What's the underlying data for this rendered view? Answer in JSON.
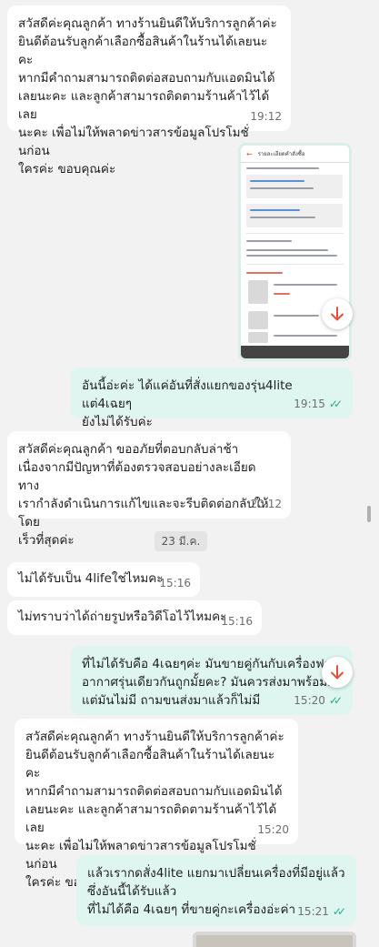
{
  "messages": [
    {
      "id": "m1",
      "side": "in",
      "text": "สวัสดีค่ะคุณลูกค้า ทางร้านยินดีให้บริการลูกค้าค่ะ\nยินดีต้อนรับลูกค้าเลือกซื้อสินค้าในร้านได้เลยนะคะ\nหากมีคำถามสามารถติดต่อสอบถามกับแอดมินได้\nเลยนะคะ และลูกค้าสามารถติดตามร้านค้าไว้ได้เลย\nนะคะ เพื่อไม่ให้พลาดข่าวสารข้อมูลโปรโมชั่นก่อน\nใครค่ะ ขอบคุณค่ะ",
      "time": "19:12"
    },
    {
      "id": "m2",
      "side": "out",
      "type": "image",
      "screenshot_title": "รายละเอียดคำสั่งซื้อ"
    },
    {
      "id": "m3",
      "side": "out",
      "text": "อันนี้อ่ะค่ะ ได้แค่อันที่สั่งแยกของรุ่น4lite แต่4เฉยๆ\nยังไม่ได้รับค่ะ",
      "time": "19:15",
      "read": true
    },
    {
      "id": "m4",
      "side": "in",
      "text": "สวัสดีค่ะคุณลูกค้า ขออภัยที่ตอบกลับล่าช้า\nเนื่องจากมีปัญหาที่ต้องตรวจสอบอย่างละเอียด ทาง\nเรากำลังดำเนินการแก้ไขและจะรีบติดต่อกลับให้โดย\nเร็วที่สุดค่ะ",
      "time": "20:12"
    },
    {
      "id": "m5",
      "side": "in",
      "text": "ไม่ได้รับเป็น 4lifeใช่ไหมคะ",
      "time": "15:16"
    },
    {
      "id": "m6",
      "side": "in",
      "text": "ไม่ทราบว่าได้ถ่ายรูปหรือวิดีโอไว้ไหมคะ",
      "time": "15:16"
    },
    {
      "id": "m7",
      "side": "out",
      "text": "ที่ไม่ได้รับคือ 4เฉยๆค่ะ มันขายคู่กันกับเครื่องฟอก\nอากาศรุ่นเดียวกันถูกมั้ยคะ? มันควรส่งมาพร้อมกั\nแต่มันไม่มี ถามขนส่งมาแล้วก็ไม่มี",
      "time": "15:20",
      "read": true
    },
    {
      "id": "m8",
      "side": "in",
      "text": "สวัสดีค่ะคุณลูกค้า ทางร้านยินดีให้บริการลูกค้าค่ะ\nยินดีต้อนรับลูกค้าเลือกซื้อสินค้าในร้านได้เลยนะคะ\nหากมีคำถามสามารถติดต่อสอบถามกับแอดมินได้\nเลยนะคะ และลูกค้าสามารถติดตามร้านค้าไว้ได้เลย\nนะคะ เพื่อไม่ให้พลาดข่าวสารข้อมูลโปรโมชั่นก่อน\nใครค่ะ ขอบคุณค่ะ",
      "time": "15:20"
    },
    {
      "id": "m9",
      "side": "out",
      "text": "แล้วเรากดสั่ง4lite แยกมาเปลี่ยนเครื่องที่มีอยู่แล้ว\nซึ่งอันนี้ได้รับแล้ว\nที่ไม่ได้คือ 4เฉยๆ ที่ขายคู่กะเครื่องอ่ะค่า",
      "time": "15:21",
      "read": true
    }
  ],
  "date_separator": "23 มี.ค.",
  "icons": {
    "scroll_down": "arrow-down-icon",
    "read_receipt": "double-check-icon"
  },
  "colors": {
    "incoming": "#ffffff",
    "outgoing": "#dff5f0",
    "accent": "#2fa391",
    "fab_arrow": "#e0533a"
  }
}
